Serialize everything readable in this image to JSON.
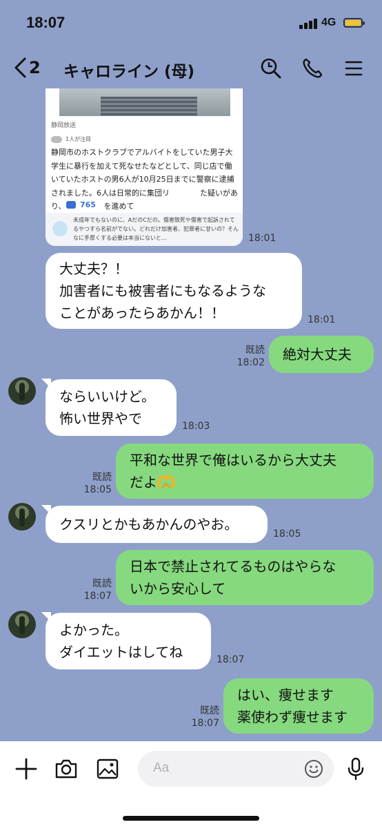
{
  "status": {
    "time": "18:07",
    "network": "4G",
    "colors": {
      "battery": "#f2c230"
    }
  },
  "header": {
    "back_count": "2",
    "title": "キャロライン (母)",
    "icons": [
      "back-chevron-icon",
      "search-icon",
      "phone-icon",
      "menu-icon"
    ]
  },
  "article": {
    "source": "静岡放送",
    "attention": "1人が注目",
    "body": "静岡市のホストクラブでアルバイトをしていた男子大学生に暴行を加えて死なせたなどとして、同じ店で働いていたホストの男6人が10月25日までに警察に逮捕されました。6人は日常的に集団リ　　　　た疑いがあり、警察が調べを進めて",
    "comment_count": "765",
    "top_comment": "未成年でもないのに、AだのCだの。傷害致死や傷害で起訴されてるやつすら名前がでない。どれだけ加害者、犯罪者に甘いの？そんなに手厚くする必要は本当にないと…",
    "time": "18:01"
  },
  "messages": [
    {
      "side": "in",
      "lines": [
        "大丈夫？！",
        "加害者にも被害者にもなるような",
        "ことがあったらあかん！！"
      ],
      "time": "18:01"
    },
    {
      "side": "out",
      "lines": [
        "絶対大丈夫"
      ],
      "read": "既読",
      "time": "18:02"
    },
    {
      "side": "in",
      "lines": [
        "ならいいけど。",
        "怖い世界やで"
      ],
      "time": "18:03"
    },
    {
      "side": "out",
      "lines": [
        "平和な世界で俺はいるから大丈夫",
        "だよ"
      ],
      "emoji": "heart-hands-emoji",
      "read": "既読",
      "time": "18:05"
    },
    {
      "side": "in",
      "lines": [
        "クスリとかもあかんのやお。"
      ],
      "time": "18:05"
    },
    {
      "side": "out",
      "lines": [
        "日本で禁止されてるものはやらな",
        "いから安心して"
      ],
      "read": "既読",
      "time": "18:07"
    },
    {
      "side": "in",
      "lines": [
        "よかった。",
        "ダイエットはしてね"
      ],
      "time": "18:07"
    },
    {
      "side": "out",
      "lines": [
        "はい、痩せます",
        "薬使わず痩せます"
      ],
      "read": "既読",
      "time": "18:07"
    }
  ],
  "composer": {
    "placeholder": "Aa",
    "icons": [
      "plus-icon",
      "camera-icon",
      "image-icon",
      "emoji-icon",
      "mic-icon"
    ]
  },
  "theme": {
    "chat_bg": "#8ea0c9",
    "outgoing": "#86d97e",
    "incoming": "#ffffff"
  }
}
